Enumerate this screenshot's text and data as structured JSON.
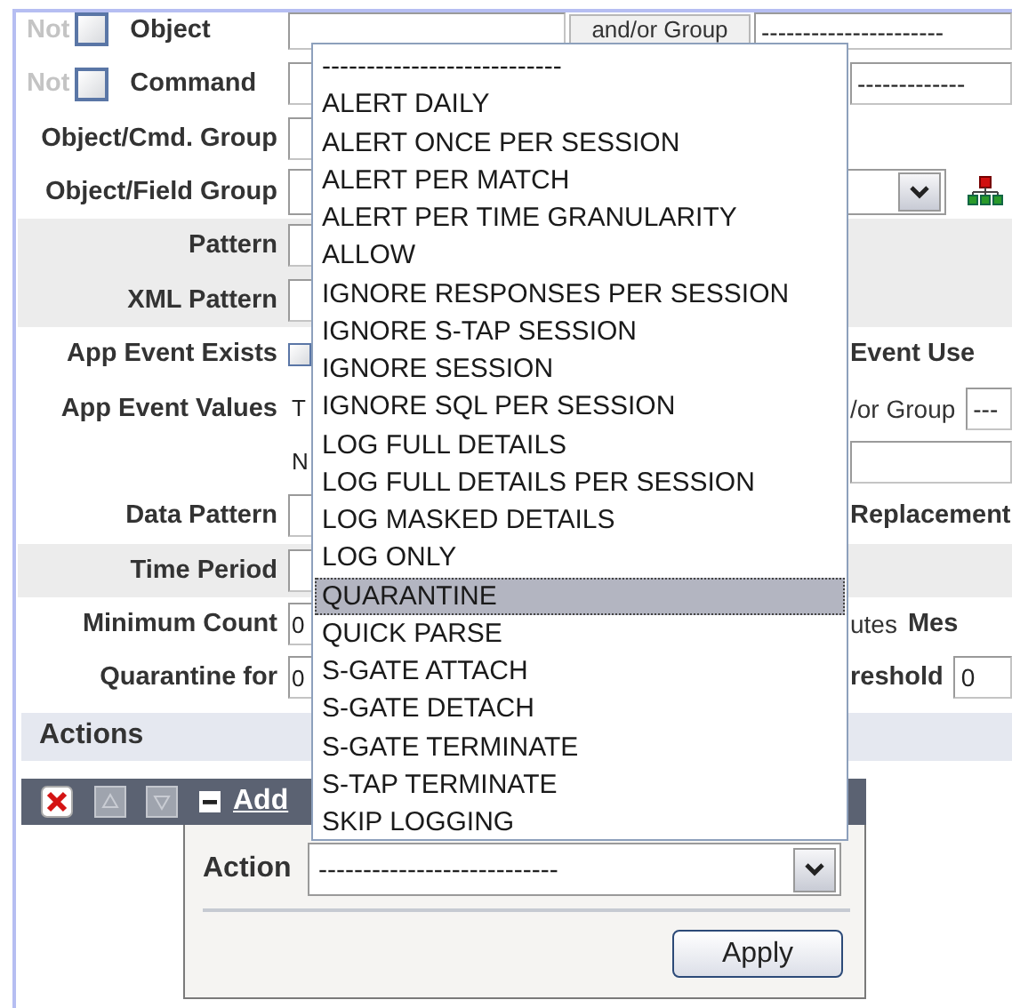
{
  "filter_rows": [
    {
      "kind": "not-check",
      "not_label": "Not",
      "checked": false,
      "label": "Object",
      "group_label": "and/or Group",
      "group_value": "----------------------"
    },
    {
      "kind": "not-check",
      "not_label": "Not",
      "checked": false,
      "label": "Command",
      "right": [
        {
          "kind": "field",
          "value": "-------------"
        }
      ]
    },
    {
      "kind": "field",
      "label": "Object/Cmd. Group"
    },
    {
      "kind": "select",
      "label": "Object/Field Group"
    },
    {
      "kind": "field",
      "label": "Pattern",
      "shaded": true
    },
    {
      "kind": "field",
      "label": "XML Pattern",
      "shaded": true
    },
    {
      "kind": "checkbox",
      "label": "App Event Exists",
      "checked": false,
      "right": [
        {
          "kind": "label",
          "text": "Event Use"
        }
      ]
    },
    {
      "kind": "text",
      "label": "App Event Values",
      "value": "T",
      "right": [
        {
          "kind": "text",
          "text": "/or Group"
        },
        {
          "kind": "field",
          "value": "---"
        }
      ]
    },
    {
      "kind": "text",
      "value": "N",
      "right": [
        {
          "kind": "field"
        }
      ]
    },
    {
      "kind": "field",
      "label": "Data Pattern",
      "right": [
        {
          "kind": "label",
          "text": "Replacement"
        }
      ]
    },
    {
      "kind": "field",
      "label": "Time Period",
      "shaded": true
    },
    {
      "kind": "field",
      "label": "Minimum Count",
      "value": "0",
      "right": [
        {
          "kind": "text",
          "text": "utes"
        },
        {
          "kind": "label",
          "text": "Mes"
        }
      ]
    },
    {
      "kind": "field",
      "label": "Quarantine for",
      "value": "0",
      "right": [
        {
          "kind": "label",
          "text": "reshold"
        },
        {
          "kind": "field",
          "value": "0"
        }
      ]
    }
  ],
  "actions_header": "Actions",
  "action_bar": {
    "link": "Add"
  },
  "action_dialog": {
    "label": "Action",
    "value": "---------------------------",
    "button": "Apply"
  },
  "action_menu": {
    "options": [
      {
        "label": "---------------------------",
        "selected": false
      },
      {
        "label": "ALERT DAILY",
        "selected": false
      },
      {
        "label": "ALERT ONCE PER SESSION",
        "selected": false
      },
      {
        "label": "ALERT PER MATCH",
        "selected": false
      },
      {
        "label": "ALERT PER TIME GRANULARITY",
        "selected": false
      },
      {
        "label": "ALLOW",
        "selected": false
      },
      {
        "label": "IGNORE RESPONSES PER SESSION",
        "selected": false
      },
      {
        "label": "IGNORE S-TAP SESSION",
        "selected": false
      },
      {
        "label": "IGNORE SESSION",
        "selected": false
      },
      {
        "label": "IGNORE SQL PER SESSION",
        "selected": false
      },
      {
        "label": "LOG FULL DETAILS",
        "selected": false
      },
      {
        "label": "LOG FULL DETAILS PER SESSION",
        "selected": false
      },
      {
        "label": "LOG MASKED DETAILS",
        "selected": false
      },
      {
        "label": "LOG ONLY",
        "selected": false
      },
      {
        "label": "QUARANTINE",
        "selected": true
      },
      {
        "label": "QUICK PARSE",
        "selected": false
      },
      {
        "label": "S-GATE ATTACH",
        "selected": false
      },
      {
        "label": "S-GATE DETACH",
        "selected": false
      },
      {
        "label": "S-GATE TERMINATE",
        "selected": false
      },
      {
        "label": "S-TAP TERMINATE",
        "selected": false
      },
      {
        "label": "SKIP LOGGING",
        "selected": false
      }
    ]
  }
}
